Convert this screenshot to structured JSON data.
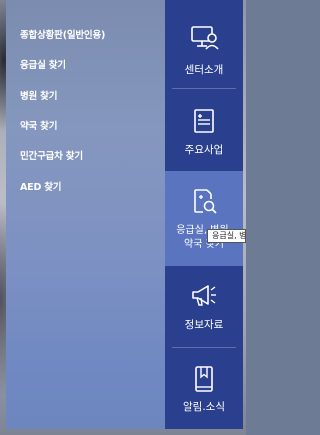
{
  "submenu": {
    "items": [
      {
        "label": "종합상황판(일반인용)"
      },
      {
        "label": "응급실 찾기"
      },
      {
        "label": "병원 찾기"
      },
      {
        "label": "약국 찾기"
      },
      {
        "label": "민간구급차 찾기"
      },
      {
        "label": "AED 찾기"
      }
    ]
  },
  "nav": {
    "items": [
      {
        "label": "센터소개",
        "icon": "presentation-board-icon"
      },
      {
        "label": "주요사업",
        "icon": "document-list-icon"
      },
      {
        "label_line1": "응급실, 병원,",
        "label_line2": "약국 찾기",
        "icon": "search-document-icon",
        "active": true
      },
      {
        "label": "정보자료",
        "icon": "megaphone-icon"
      },
      {
        "label": "알림.소식",
        "icon": "bookmark-book-icon"
      }
    ]
  },
  "tooltip": {
    "text": "응급실, 병원, 약국 찾기"
  },
  "colors": {
    "nav_bg": "#2b3f8f",
    "nav_active": "#5a74c0",
    "submenu_bg": "#7d91c3",
    "text": "#ffffff"
  }
}
